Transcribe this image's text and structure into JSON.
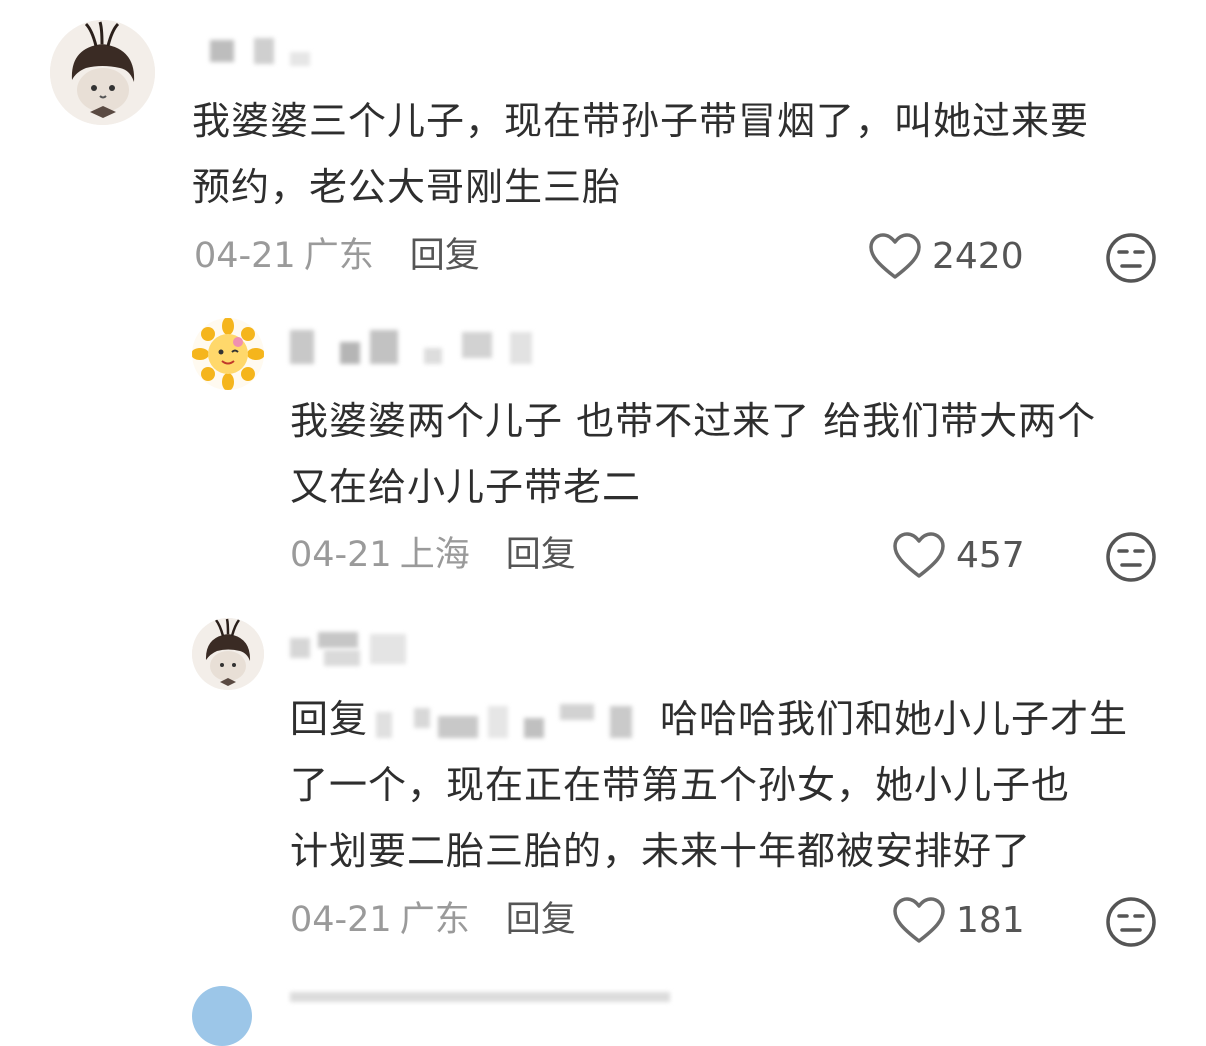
{
  "comments": [
    {
      "text_line1": "我婆婆三个儿子，现在带孙子带冒烟了，叫她过来要",
      "text_line2": "预约，老公大哥刚生三胎",
      "date": "04-21",
      "location": "广东",
      "reply_label": "回复",
      "likes": "2420",
      "avatar_icon": "cat-with-wig-avatar-icon"
    },
    {
      "text_line1": "我婆婆两个儿子 也带不过来了 给我们带大两个",
      "text_line2": "又在给小儿子带老二",
      "date": "04-21",
      "location": "上海",
      "reply_label": "回复",
      "likes": "457",
      "avatar_icon": "sunflower-avatar-icon"
    },
    {
      "reply_prefix": "回复",
      "text_line1_tail": "哈哈哈我们和她小儿子才生",
      "text_line2": "了一个，现在正在带第五个孙女，她小儿子也",
      "text_line3": "计划要二胎三胎的，未来十年都被安排好了",
      "date": "04-21",
      "location": "广东",
      "reply_label": "回复",
      "likes": "181",
      "avatar_icon": "cat-with-wig-avatar-icon"
    }
  ],
  "icons": {
    "like": "heart-outline-icon",
    "reaction": "neutral-face-icon"
  },
  "colors": {
    "text": "#2e2e2e",
    "meta": "#9a9a9a",
    "action": "#555555"
  }
}
